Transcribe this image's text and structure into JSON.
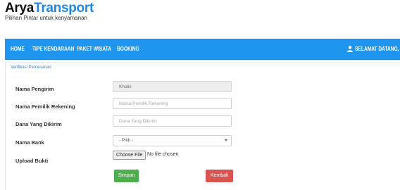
{
  "brand": {
    "name_part1": "Arya",
    "name_part2": "Transport",
    "tagline": "Pilihan Pintar untuk kenyamanan"
  },
  "nav": {
    "items": [
      "HOME",
      "TIPE KENDARAAN",
      "PAKET WISATA",
      "BOOKING"
    ],
    "user_greeting": "SELAMAT DATANG, KHOLIK"
  },
  "breadcrumb": "Verifikasi Pemesanan",
  "form": {
    "sender_label": "Nama Pengirim",
    "sender_value": "Kholik",
    "account_label": "Nama Pemilik Rekening",
    "account_placeholder": "Nama Pemilik Rekening",
    "amount_label": "Dana Yang Dikirim",
    "amount_placeholder": "Dana Yang Dikirim",
    "bank_label": "Nama Bank",
    "bank_selected": "- Pilih -",
    "upload_label": "Upload Bukti",
    "file_button": "Choose File",
    "file_status": "No file chosen"
  },
  "buttons": {
    "save": "Simpan",
    "back": "Kembali"
  },
  "colors": {
    "navbar": "#1e96f0",
    "brand_accent": "#1e88e5",
    "save": "#4cae4c",
    "back": "#d9534f"
  }
}
